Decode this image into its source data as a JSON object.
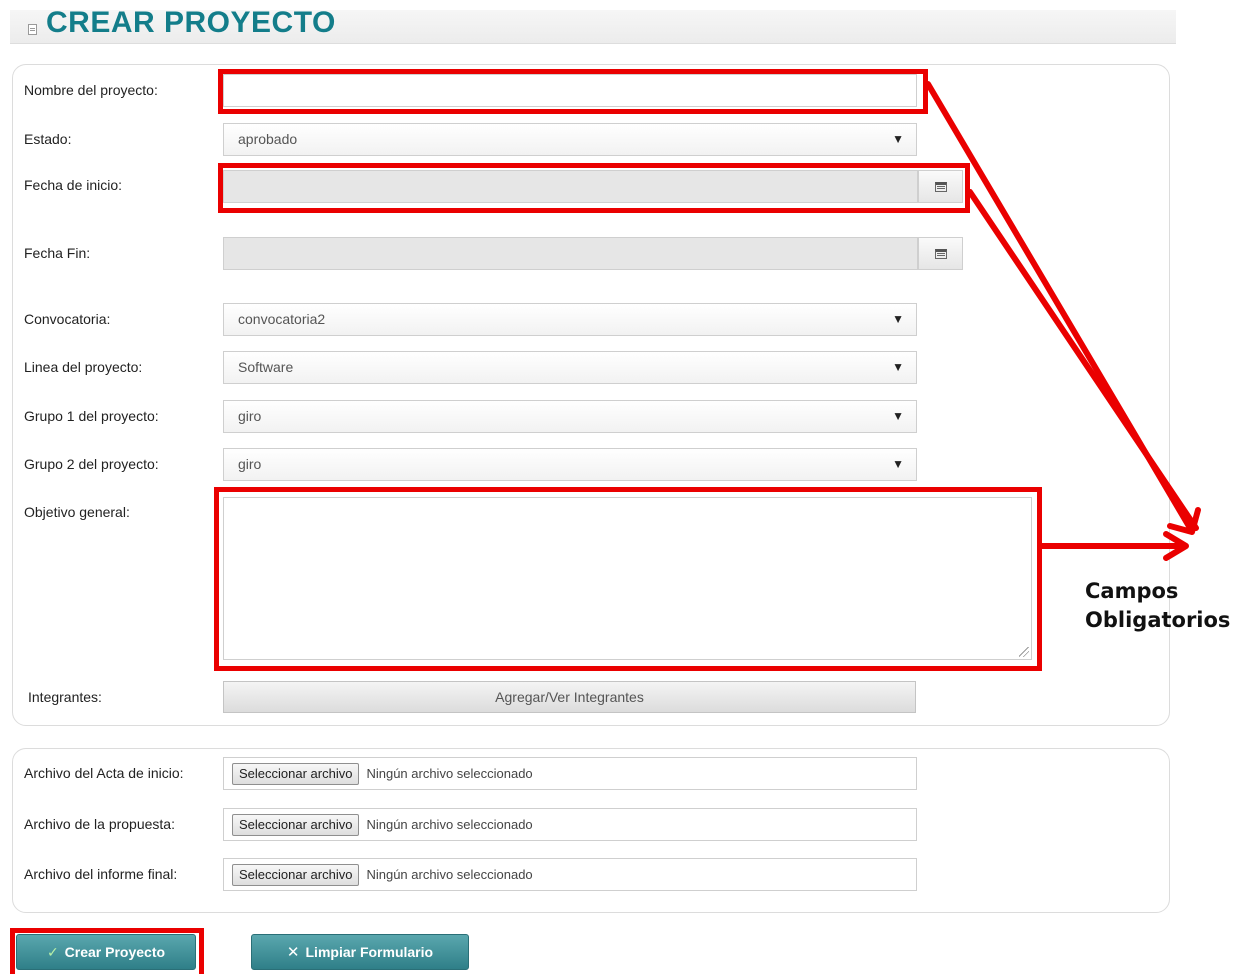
{
  "page": {
    "title": "CREAR PROYECTO"
  },
  "form": {
    "nombre": {
      "label": "Nombre del proyecto:",
      "value": ""
    },
    "estado": {
      "label": "Estado:",
      "value": "aprobado"
    },
    "fecha_inicio": {
      "label": "Fecha de inicio:",
      "value": ""
    },
    "fecha_fin": {
      "label": "Fecha Fin:",
      "value": ""
    },
    "convocatoria": {
      "label": "Convocatoria:",
      "value": "convocatoria2"
    },
    "linea": {
      "label": "Linea del proyecto:",
      "value": "Software"
    },
    "grupo1": {
      "label": "Grupo 1 del proyecto:",
      "value": "giro"
    },
    "grupo2": {
      "label": "Grupo 2 del proyecto:",
      "value": "giro"
    },
    "objetivo": {
      "label": "Objetivo general:",
      "value": ""
    },
    "integrantes": {
      "label": "Integrantes:",
      "button": "Agregar/Ver Integrantes"
    }
  },
  "files": {
    "button_label": "Seleccionar archivo",
    "status": "Ningún archivo seleccionado",
    "acta": {
      "label": "Archivo del Acta de inicio:"
    },
    "propuesta": {
      "label": "Archivo de la propuesta:"
    },
    "informe": {
      "label": "Archivo del informe final:"
    }
  },
  "actions": {
    "create": "Crear Proyecto",
    "clear": "Limpiar Formulario"
  },
  "annotation": {
    "line1": "Campos",
    "line2": "Obligatorios"
  },
  "icons": {
    "select_arrow": "▼",
    "calendar": "calendar-icon",
    "check": "✓",
    "clear": "✕"
  },
  "colors": {
    "title": "#137d8a",
    "button": "#2f7f88",
    "highlight": "#ea0000"
  }
}
